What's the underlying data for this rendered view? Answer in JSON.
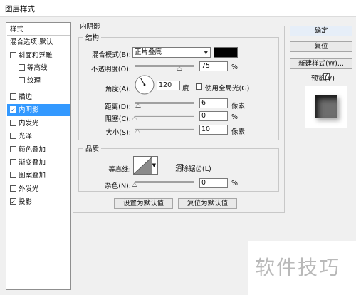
{
  "window": {
    "title": "图层样式"
  },
  "sidebar": {
    "items": [
      {
        "label": "样式",
        "checkbox": null,
        "checked": false,
        "selected": false
      },
      {
        "label": "混合选项:默认",
        "checkbox": null,
        "checked": false,
        "selected": false
      },
      {
        "label": "斜面和浮雕",
        "checkbox": true,
        "checked": false,
        "selected": false
      },
      {
        "label": "等高线",
        "checkbox": true,
        "checked": false,
        "selected": false
      },
      {
        "label": "纹理",
        "checkbox": true,
        "checked": false,
        "selected": false
      },
      {
        "label": "描边",
        "checkbox": true,
        "checked": false,
        "selected": false
      },
      {
        "label": "内阴影",
        "checkbox": true,
        "checked": true,
        "selected": true
      },
      {
        "label": "内发光",
        "checkbox": true,
        "checked": false,
        "selected": false
      },
      {
        "label": "光泽",
        "checkbox": true,
        "checked": false,
        "selected": false
      },
      {
        "label": "颜色叠加",
        "checkbox": true,
        "checked": false,
        "selected": false
      },
      {
        "label": "渐变叠加",
        "checkbox": true,
        "checked": false,
        "selected": false
      },
      {
        "label": "图案叠加",
        "checkbox": true,
        "checked": false,
        "selected": false
      },
      {
        "label": "外发光",
        "checkbox": true,
        "checked": false,
        "selected": false
      },
      {
        "label": "投影",
        "checkbox": true,
        "checked": true,
        "selected": false
      }
    ]
  },
  "inner_shadow": {
    "title": "内阴影",
    "structure": {
      "title": "结构",
      "blend_mode": {
        "label": "混合模式(B):",
        "value": "正片叠底",
        "color": "#000000"
      },
      "opacity": {
        "label": "不透明度(O):",
        "value": "75",
        "unit": "%",
        "level": 0.75
      },
      "angle": {
        "label": "角度(A):",
        "value": "120",
        "unit": "度",
        "degrees": 120
      },
      "global_light": {
        "label": "使用全局光(G)",
        "checked": false
      },
      "distance": {
        "label": "距离(D):",
        "value": "6",
        "unit": "像素",
        "level": 0.06
      },
      "choke": {
        "label": "阻塞(C):",
        "value": "0",
        "unit": "%",
        "level": 0.0
      },
      "size": {
        "label": "大小(S):",
        "value": "10",
        "unit": "像素",
        "level": 0.05
      }
    },
    "quality": {
      "title": "品质",
      "contour": {
        "label": "等高线:"
      },
      "anti_alias": {
        "label": "消除锯齿(L)",
        "checked": false
      },
      "noise": {
        "label": "杂色(N):",
        "value": "0",
        "unit": "%",
        "level": 0.0
      }
    },
    "buttons": {
      "set_default": "设置为默认值",
      "reset_default": "复位为默认值"
    }
  },
  "actions": {
    "ok": "确定",
    "reset": "复位",
    "new_style": "新建样式(W)...",
    "preview": {
      "label": "预览(V)",
      "checked": true
    }
  },
  "watermark": {
    "text": "软件技巧"
  }
}
